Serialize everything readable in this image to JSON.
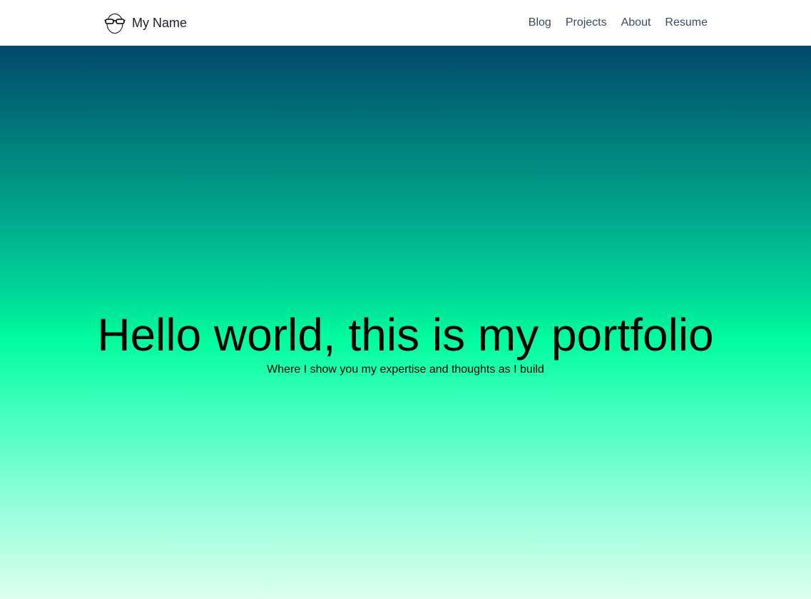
{
  "navbar": {
    "brand_logo_icon": "glasses-face-icon",
    "brand_name": "My Name",
    "links": [
      {
        "label": "Blog"
      },
      {
        "label": "Projects"
      },
      {
        "label": "About"
      },
      {
        "label": "Resume"
      }
    ]
  },
  "hero": {
    "title": "Hello world, this is my portfolio",
    "subtitle": "Where I show you my expertise and thoughts as I build",
    "gradient_colors": [
      "#004a6a",
      "#00a58a",
      "#00fd9c",
      "#8fffd9",
      "#dcfff1"
    ]
  }
}
